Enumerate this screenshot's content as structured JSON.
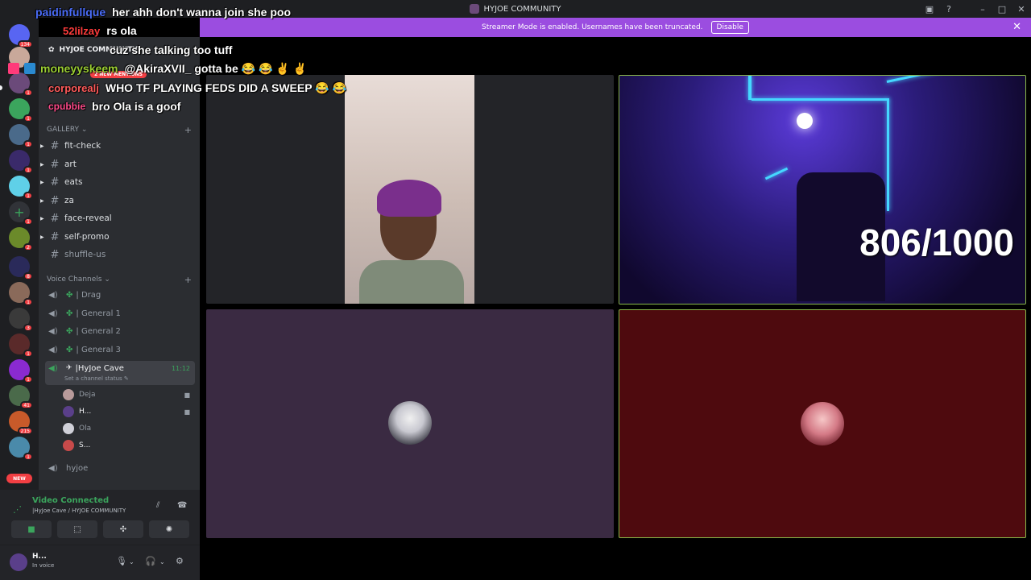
{
  "window": {
    "title": "HYJOE COMMUNITY"
  },
  "banner": {
    "text": "Streamer Mode is enabled. Usernames have been truncated.",
    "button": "Disable"
  },
  "rail": {
    "badges": [
      "134",
      "1",
      "1",
      "1",
      "1",
      "1",
      "1",
      "1",
      "1",
      "2",
      "8",
      "1",
      "3",
      "1",
      "1",
      "41",
      "215",
      "1"
    ],
    "new_label": "NEW"
  },
  "sidebar": {
    "server_name": "HYJOE COMMUNITY",
    "mentions": "2 NEW MENTIONS",
    "gallery_category": "GALLERY",
    "text_channels": [
      "fit-check",
      "art",
      "eats",
      "za",
      "face-reveal",
      "self-promo",
      "shuffle-us"
    ],
    "voice_category": "Voice Channels",
    "voice_channels": [
      "| Drag",
      "| General 1",
      "| General 2",
      "| General 3"
    ],
    "active_channel": {
      "name": "|HyJoe Cave",
      "time": "11:12",
      "status": "Set a channel status"
    },
    "voice_users": [
      "Deja",
      "H...",
      "Ola",
      "S..."
    ],
    "after_channel": "hyjoe"
  },
  "voice_panel": {
    "title": "Video Connected",
    "subtitle": "|HyJoe Cave / HYJOE COMMUNITY"
  },
  "user_panel": {
    "name": "H...",
    "status": "In voice"
  },
  "streams": {
    "counter": "806/1000"
  },
  "chat": [
    {
      "name": "paidinfullque",
      "name_color": "#4a6cf7",
      "text": "her ahh don't wanna join she poo"
    },
    {
      "name": "52lilzay",
      "name_color": "#ff3b3b",
      "text": "rs ola"
    },
    {
      "name": "",
      "name_color": "#ffffff",
      "text": "cuz she talking too tuff"
    },
    {
      "name": "moneyyskeem",
      "name_color": "#9acd32",
      "text": "@AkiraXVII_ gotta be 😂 😂 ✌️ ✌️"
    },
    {
      "name": "corporealj",
      "name_color": "#ff5a5a",
      "text": "WHO TF PLAYING FEDS DID A SWEEP 😂 😂"
    },
    {
      "name": "cpubbie",
      "name_color": "#ff4a8a",
      "text": "bro Ola is a goof"
    }
  ],
  "colors": {
    "accent": "#9b4de0",
    "online": "#3ba55d",
    "danger": "#f23f43"
  }
}
